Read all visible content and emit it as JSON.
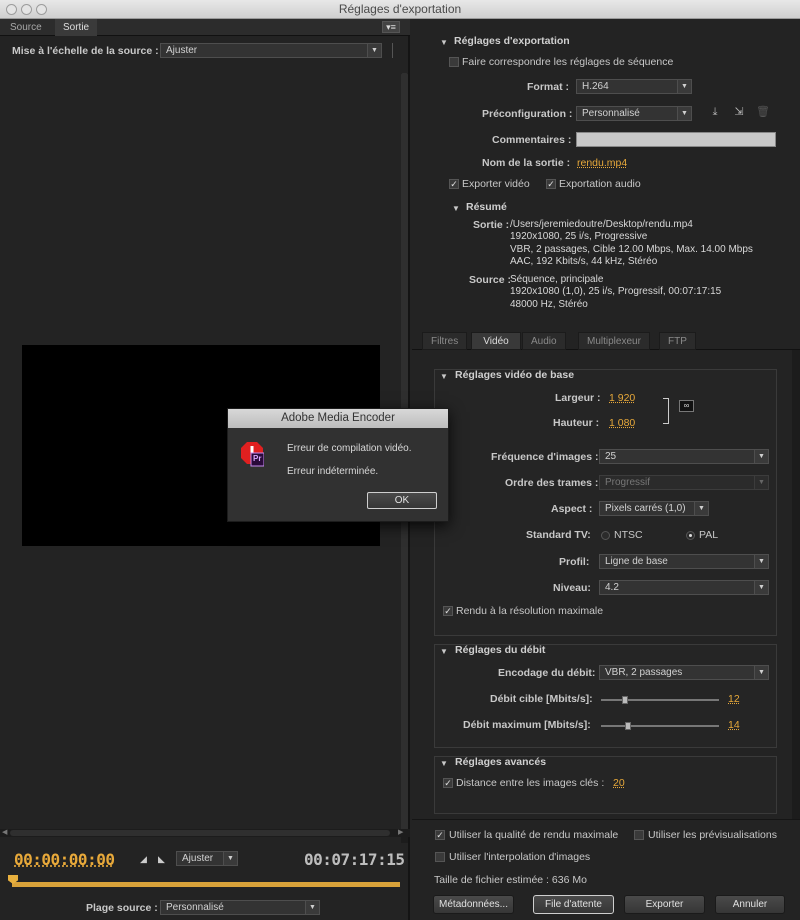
{
  "window": {
    "title": "Réglages d'exportation"
  },
  "left": {
    "tabs": [
      "Source",
      "Sortie"
    ],
    "scale_label": "Mise à l'échelle de la source :",
    "scale_value": "Ajuster",
    "timecode_in": "00:00:00:00",
    "zoom_value": "Ajuster",
    "timecode_duration": "00:07:17:15",
    "range_label": "Plage source :",
    "range_value": "Personnalisé"
  },
  "dialog": {
    "title": "Adobe Media Encoder",
    "line1": "Erreur de compilation vidéo.",
    "line2": "Erreur indéterminée.",
    "ok": "OK",
    "icon_badge": "Pr"
  },
  "export": {
    "section_title": "Réglages d'exportation",
    "match_label": "Faire correspondre les réglages de séquence",
    "format_label": "Format :",
    "format_value": "H.264",
    "preset_label": "Préconfiguration :",
    "preset_value": "Personnalisé",
    "comments_label": "Commentaires :",
    "output_label": "Nom de la sortie :",
    "output_value": "rendu.mp4",
    "export_video": "Exporter vidéo",
    "export_audio": "Exportation audio",
    "summary_title": "Résumé",
    "output_summary_label": "Sortie :",
    "output_summary": [
      "/Users/jeremiedoutre/Desktop/rendu.mp4",
      "1920x1080, 25 i/s, Progressive",
      "VBR, 2 passages, Cible 12.00 Mbps, Max. 14.00 Mbps",
      "AAC, 192  Kbits/s, 44  kHz, Stéréo"
    ],
    "source_summary_label": "Source :",
    "source_summary": [
      "Séquence, principale",
      "1920x1080 (1,0), 25  i/s, Progressif, 00:07:17:15",
      "48000 Hz, Stéréo"
    ]
  },
  "tabs": [
    "Filtres",
    "Vidéo",
    "Audio",
    "Multiplexeur",
    "FTP"
  ],
  "video": {
    "section_title": "Réglages vidéo de base",
    "width_label": "Largeur :",
    "width_value": "1 920",
    "height_label": "Hauteur :",
    "height_value": "1 080",
    "framerate_label": "Fréquence d'images :",
    "framerate_value": "25",
    "field_label": "Ordre des trames :",
    "field_value": "Progressif",
    "aspect_label": "Aspect :",
    "aspect_value": "Pixels carrés (1,0)",
    "tv_label": "Standard TV:",
    "tv_ntsc": "NTSC",
    "tv_pal": "PAL",
    "profile_label": "Profil:",
    "profile_value": "Ligne de base",
    "level_label": "Niveau:",
    "level_value": "4.2",
    "maxres_label": "Rendu à la résolution maximale"
  },
  "bitrate": {
    "section_title": "Réglages du débit",
    "encoding_label": "Encodage du débit:",
    "encoding_value": "VBR, 2 passages",
    "target_label": "Débit cible [Mbits/s]:",
    "target_value": "12",
    "target_fraction": 0.2,
    "max_label": "Débit maximum [Mbits/s]:",
    "max_value": "14",
    "max_fraction": 0.23
  },
  "advanced": {
    "section_title": "Réglages avancés",
    "keyframe_label": "Distance entre les images clés :",
    "keyframe_value": "20"
  },
  "bottom": {
    "max_quality": "Utiliser la qualité de rendu maximale",
    "previews": "Utiliser les prévisualisations",
    "interp": "Utiliser l'interpolation d'images",
    "filesize": "Taille de fichier estimée : 636 Mo",
    "metadata_btn": "Métadonnées...",
    "queue_btn": "File d'attente",
    "export_btn": "Exporter",
    "cancel_btn": "Annuler"
  }
}
